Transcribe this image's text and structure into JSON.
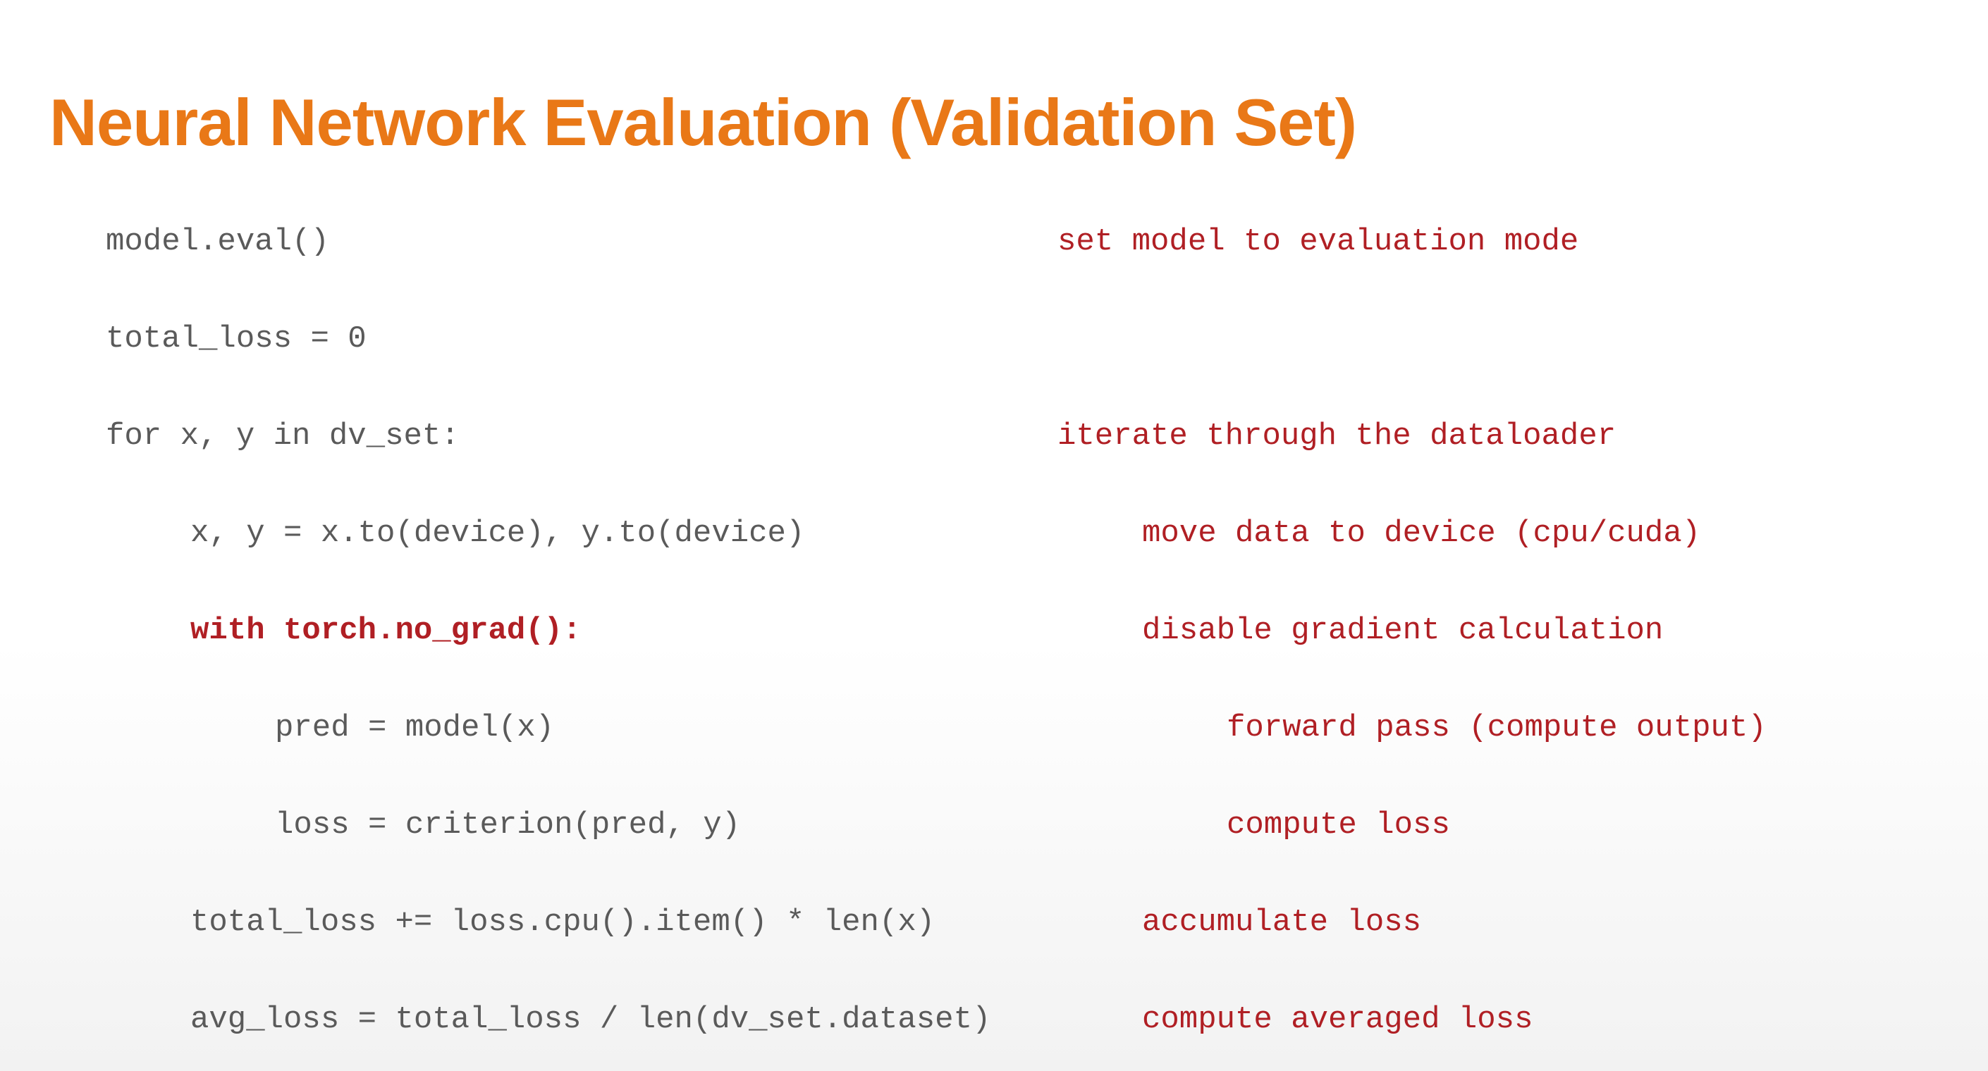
{
  "title": "Neural Network Evaluation (Validation Set)",
  "rows": [
    {
      "code": "model.eval()",
      "comment": "set model to evaluation mode",
      "indent": 0,
      "em": false
    },
    {
      "code": "total_loss = 0",
      "comment": "",
      "indent": 0,
      "em": false
    },
    {
      "code": "for x, y in dv_set:",
      "comment": "iterate through the dataloader",
      "indent": 0,
      "em": false
    },
    {
      "code": "x, y = x.to(device), y.to(device)",
      "comment": "move data to device (cpu/cuda)",
      "indent": 1,
      "em": false
    },
    {
      "code": "with torch.no_grad():",
      "comment": "disable gradient calculation",
      "indent": 1,
      "em": true
    },
    {
      "code": "pred = model(x)",
      "comment": "forward pass (compute output)",
      "indent": 2,
      "em": false
    },
    {
      "code": "loss = criterion(pred, y)",
      "comment": "compute loss",
      "indent": 2,
      "em": false
    },
    {
      "code": "total_loss += loss.cpu().item() * len(x)",
      "comment": "accumulate loss",
      "indent": 1,
      "em": false
    },
    {
      "code": "avg_loss = total_loss / len(dv_set.dataset)",
      "comment": "compute averaged loss",
      "indent": 1,
      "em": false
    }
  ]
}
